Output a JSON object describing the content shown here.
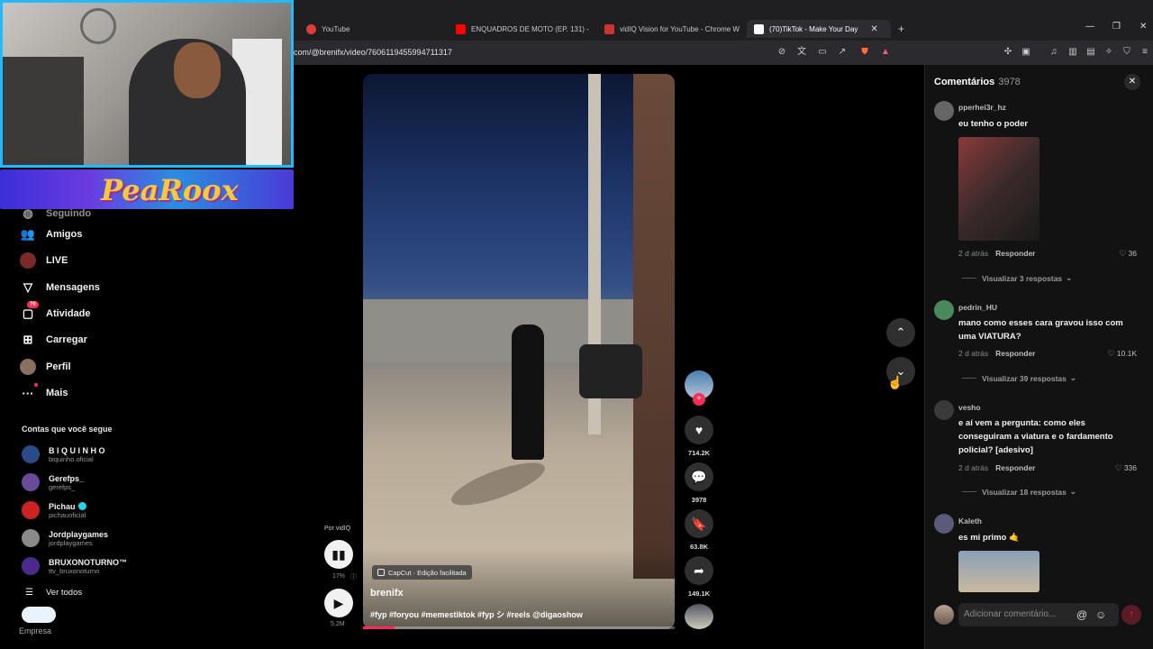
{
  "browser": {
    "tabs": [
      {
        "label": "YouTube",
        "color": "#e23b3b"
      },
      {
        "label": "ENQUADROS DE MOTO (EP. 131) - Y",
        "color": "#ff0000"
      },
      {
        "label": "vidIQ Vision for YouTube - Chrome W",
        "color": "#cc3333"
      },
      {
        "label": "(70)TikTok - Make Your Day",
        "color": "#ffffff"
      }
    ],
    "url": "com/@brenifx/video/7606119455994711317"
  },
  "sidebar": {
    "partial_item": "Seguindo",
    "items": [
      {
        "label": "Amigos",
        "icon": "friends-icon"
      },
      {
        "label": "LIVE",
        "icon": "live-icon"
      },
      {
        "label": "Mensagens",
        "icon": "messages-icon"
      },
      {
        "label": "Atividade",
        "icon": "activity-icon",
        "badge": "70"
      },
      {
        "label": "Carregar",
        "icon": "upload-icon"
      },
      {
        "label": "Perfil",
        "icon": "profile-icon"
      },
      {
        "label": "Mais",
        "icon": "more-icon"
      }
    ],
    "following_title": "Contas que você segue",
    "following": [
      {
        "name": "B I Q U I N H O",
        "handle": "biquinho.oficial",
        "color": "#2a4a8a"
      },
      {
        "name": "Gerefps_",
        "handle": "gerefps_",
        "color": "#6a4a9a"
      },
      {
        "name": "Pichau",
        "handle": "pichauoficial",
        "color": "#c22",
        "verified": true
      },
      {
        "name": "Jordplaygames",
        "handle": "jordplaygames",
        "color": "#8a8a8a"
      },
      {
        "name": "BRUXONOTURNO™",
        "handle": "ttv_bruxonoturno",
        "color": "#4a2a8a"
      }
    ],
    "see_all": "Ver todos",
    "business": "Empresa"
  },
  "webcam": {
    "banner_text": "PeaRoox"
  },
  "video": {
    "capcut_label": "CapCut · Edição facilitada",
    "author": "brenifx",
    "tags": "#fyp #foryou #memestiktok #fyp シ #reels @digaoshow",
    "progress": 0.1
  },
  "vidiq": {
    "label": "Por vidIQ",
    "percent": "17%",
    "views": "5.2M"
  },
  "actions": {
    "likes": "714.2K",
    "comments": "3978",
    "saves": "63.8K",
    "shares": "149.1K"
  },
  "comments_panel": {
    "title": "Comentários",
    "count": "3978",
    "input_placeholder": "Adicionar comentário...",
    "comments": [
      {
        "user": "pperhei3r_hz",
        "text": "eu tenho o poder",
        "time": "2 d atrás",
        "reply": "Responder",
        "likes": "36",
        "replies": "Visualizar 3 respostas",
        "avatar_color": "#666"
      },
      {
        "user": "pedrin_HU",
        "text": "mano como esses cara gravou isso com uma VIATURA?",
        "time": "2 d atrás",
        "reply": "Responder",
        "likes": "10.1K",
        "replies": "Visualizar 39 respostas",
        "avatar_color": "#4a8a5a"
      },
      {
        "user": "vesho",
        "text": "e aí vem a pergunta: como eles conseguiram a viatura e o fardamento policial? [adesivo]",
        "time": "2 d atrás",
        "reply": "Responder",
        "likes": "336",
        "replies": "Visualizar 18 respostas",
        "avatar_color": "#3a3a3a"
      },
      {
        "user": "Kaleth",
        "text": "es mi primo 🤙",
        "avatar_color": "#5a5a7a"
      }
    ]
  }
}
